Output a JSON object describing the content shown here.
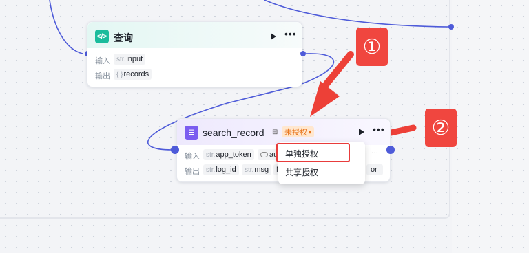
{
  "nodes": {
    "query": {
      "title": "查询",
      "icon": "code-icon",
      "input_label": "输入",
      "output_label": "输出",
      "input_type": "str.",
      "input_name": "input",
      "output_type": "{ }",
      "output_name": "records"
    },
    "search_record": {
      "title": "search_record",
      "icon": "table-icon",
      "auth_badge": "未授权",
      "input_label": "输入",
      "output_label": "输出",
      "inputs": [
        {
          "type": "str.",
          "name": "app_token"
        },
        {
          "type": "toggle",
          "name": "au"
        }
      ],
      "outputs": [
        {
          "type": "str.",
          "name": "log_id"
        },
        {
          "type": "str.",
          "name": "msg"
        },
        {
          "type": "",
          "name": "N"
        },
        {
          "type": "",
          "name": "or"
        }
      ]
    }
  },
  "auth_menu": {
    "items": [
      "单独授权",
      "共享授权"
    ]
  },
  "annotations": {
    "step1": "①",
    "step2": "②"
  },
  "colors": {
    "accent": "#4e5bd9",
    "annotation_red": "#f0463f",
    "badge_bg": "#ffe7cf",
    "badge_text": "#e8731a"
  }
}
